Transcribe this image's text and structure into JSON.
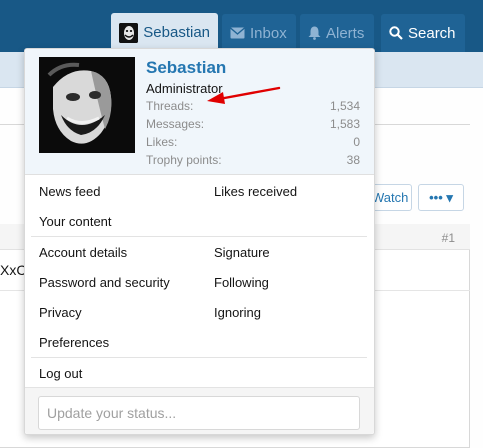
{
  "nav": {
    "user_label": "Sebastian",
    "inbox_label": "Inbox",
    "alerts_label": "Alerts",
    "search_label": "Search"
  },
  "background": {
    "watch_label": "Watch",
    "more_label": "••• ▾",
    "post_number": "#1",
    "post_text_fragment": "XxCl"
  },
  "menu": {
    "user": {
      "name": "Sebastian",
      "title": "Administrator",
      "stats": [
        {
          "label": "Threads:",
          "value": "1,534"
        },
        {
          "label": "Messages:",
          "value": "1,583"
        },
        {
          "label": "Likes:",
          "value": "0"
        },
        {
          "label": "Trophy points:",
          "value": "38"
        }
      ]
    },
    "links": {
      "news_feed": "News feed",
      "likes_received": "Likes received",
      "your_content": "Your content",
      "account_details": "Account details",
      "signature": "Signature",
      "password_security": "Password and security",
      "following": "Following",
      "privacy": "Privacy",
      "ignoring": "Ignoring",
      "preferences": "Preferences",
      "log_out": "Log out"
    },
    "status_placeholder": "Update your status..."
  },
  "colors": {
    "navbar": "#185886",
    "accent": "#2577b1",
    "annotation_arrow": "#e00000"
  }
}
